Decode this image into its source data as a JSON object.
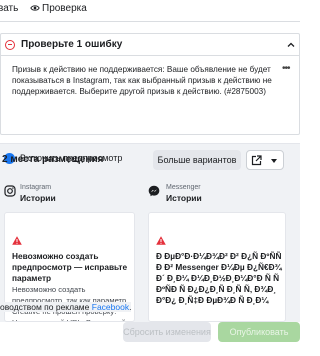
{
  "tabs": {
    "edit": "вать",
    "review": "Проверка"
  },
  "error": {
    "title": "Проверьте 1 ошибку",
    "message": "Призыв к действию не поддерживается: Ваше объявление не будет показываться в Instagram, так как выбранный призыв к действию не поддерживается. Выберите другой призыв к действию. (#2875003)"
  },
  "preview_toggle": {
    "label": "Включить предпросмотр"
  },
  "placements": {
    "title": "2 места размещения",
    "more_button": "Больше вариантов"
  },
  "instagram": {
    "name": "Instagram",
    "placement": "Истории",
    "error_title": "Невозможно создать предпросмотр — исправьте параметр",
    "error_body": "Невозможно создать предпросмотр, так как параметр Creative не прошел проверку: Недопустимый URL: Введенный"
  },
  "messenger": {
    "name": "Messenger",
    "placement": "Истории",
    "error_garbled": "Ð ÐµÐ°Ð·Ð¼Ð¾Ð² Ð² Ð¿Ñ ÐºÑÑ Ð Ð² Messenger Ð¼Ðµ Ð¿Ñ€Ð¾Ð´ Ð¸Ð¼ Ð¼Ð¸Ð½Ð¸Ð¼Ð°Ð Ñ Ñ ÐºÑÐ Ñ Ð¿Ð¿Ð¸Ñ Ð¸Ñ Ñ‚ Ð¾Ð¸ Ð°Ð¿ Ð¸Ñ‡Ð ÐµÐ¾Ð Ñ Ð¸Ð¼"
  },
  "footer": {
    "text_prefix": "оводством по рекламе",
    "link_text": "Facebook",
    "cancel_label": "Сбросить изменения",
    "publish_label": "Опубликовать"
  },
  "colors": {
    "accent": "#1877f2",
    "error": "#e4303b",
    "panel": "#f0f2f5"
  }
}
